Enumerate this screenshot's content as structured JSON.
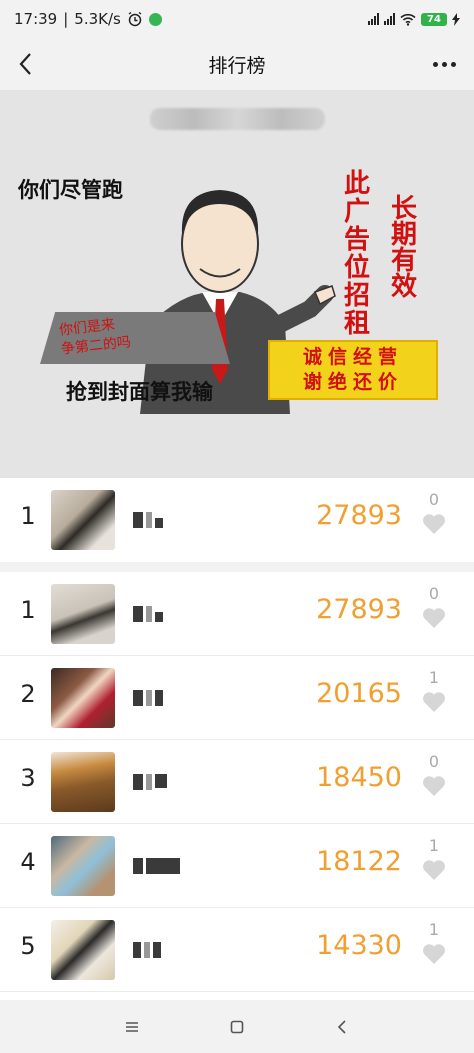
{
  "status_bar": {
    "time": "17:39",
    "speed": "5.3K/s",
    "battery": "74"
  },
  "nav": {
    "title": "排行榜"
  },
  "banner": {
    "text_run": "你们尽管跑",
    "text_cover": "抢到封面算我输",
    "speech": [
      "你们是来",
      "争第二的吗"
    ],
    "ad_col1": [
      "此",
      "广",
      "告",
      "位",
      "招",
      "租"
    ],
    "ad_col2": [
      "长",
      "期",
      "有",
      "效"
    ],
    "ad_box": [
      "诚信经营",
      "谢绝还价"
    ]
  },
  "my_entry": {
    "rank": "1",
    "score": "27893",
    "likes": "0"
  },
  "leaderboard": [
    {
      "rank": "1",
      "score": "27893",
      "likes": "0"
    },
    {
      "rank": "2",
      "score": "20165",
      "likes": "1"
    },
    {
      "rank": "3",
      "score": "18450",
      "likes": "0"
    },
    {
      "rank": "4",
      "score": "18122",
      "likes": "1"
    },
    {
      "rank": "5",
      "score": "14330",
      "likes": "1"
    }
  ],
  "colors": {
    "score": "#f0a030",
    "ad_red": "#d21010",
    "ad_yellow": "#f2d21a"
  },
  "icons": {
    "back": "chevron-left-icon",
    "more": "more-dots-icon",
    "like": "heart-icon",
    "menu": "menu-icon",
    "home": "square-home-icon",
    "back_nav": "triangle-back-icon"
  }
}
